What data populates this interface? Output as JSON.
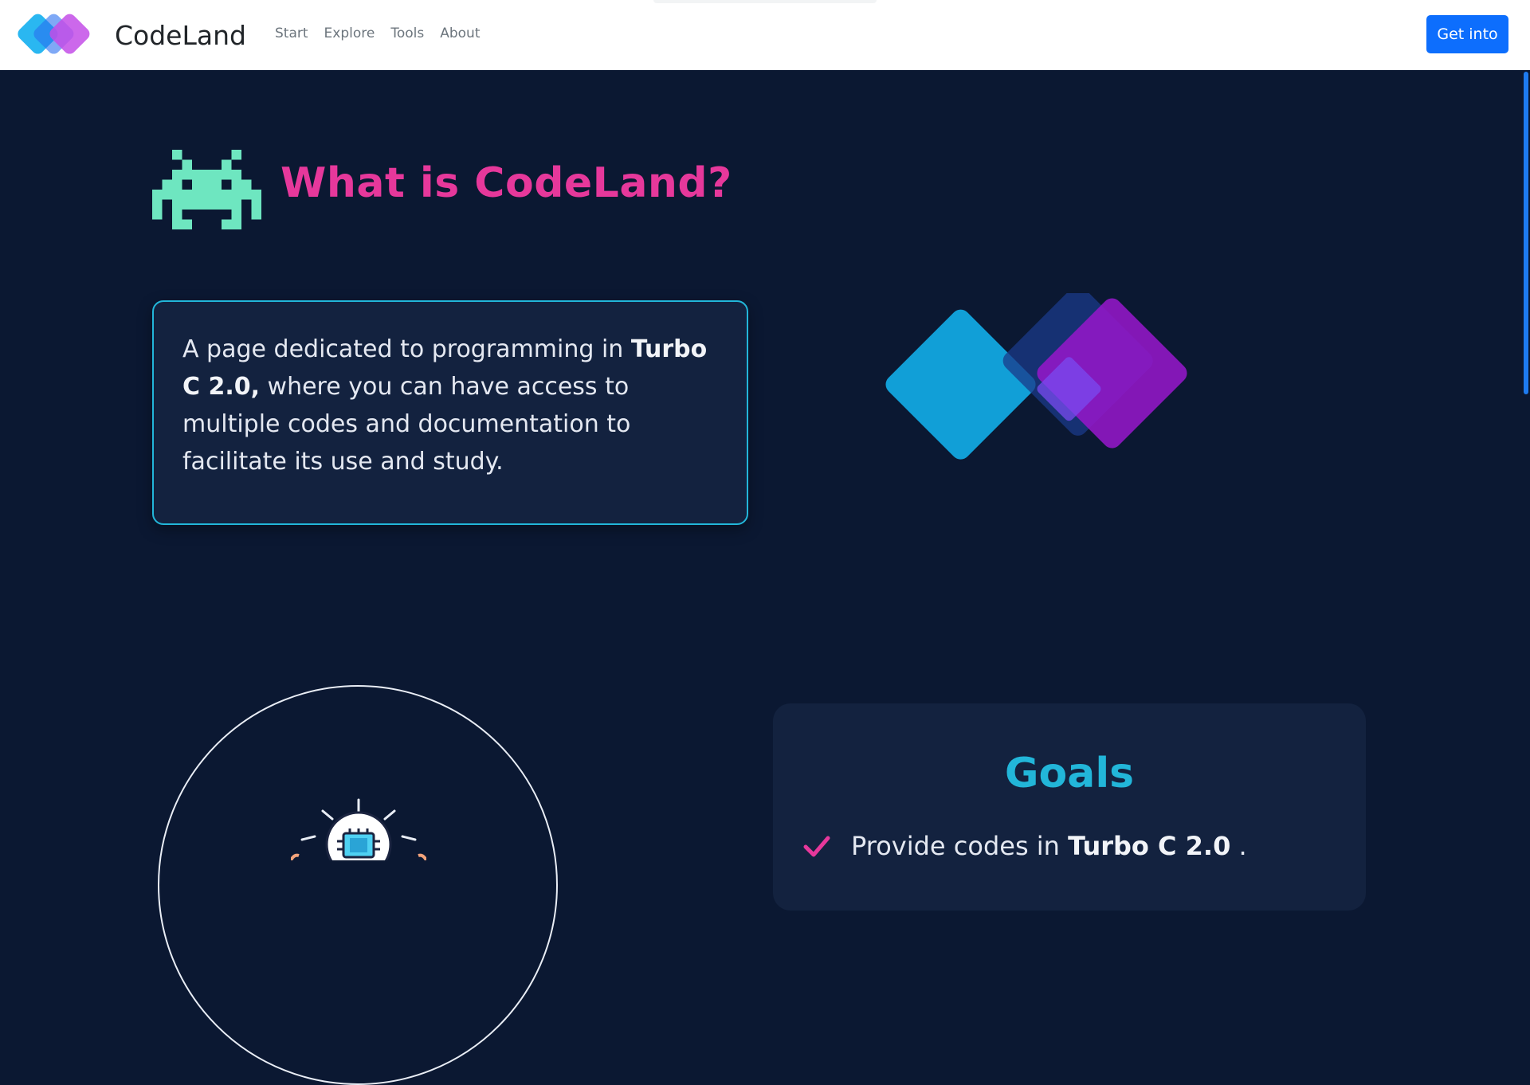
{
  "navbar": {
    "brand_name": "CodeLand",
    "links": [
      "Start",
      "Explore",
      "Tools",
      "About"
    ],
    "cta_label": "Get into"
  },
  "hero": {
    "title": "What is CodeLand?",
    "description": {
      "part1": "A page dedicated to programming in ",
      "bold1": "Turbo C 2.0,",
      "part2": " where you can have access to multiple codes and documentation to facilitate its use and study."
    }
  },
  "goals": {
    "title": "Goals",
    "items": [
      {
        "prefix": "Provide codes in ",
        "bold": "Turbo C 2.0",
        "suffix": " ."
      }
    ]
  },
  "colors": {
    "background": "#0b1832",
    "card": "#13223f",
    "accent_pink": "#e6389b",
    "accent_cyan": "#22b6d9",
    "invader_green": "#6ee6c0",
    "button_blue": "#0d6efd"
  },
  "icons": [
    "brand-logo-icon",
    "space-invader-icon",
    "overlapping-diamonds-icon",
    "lightbulb-chip-icon",
    "checkmark-icon"
  ]
}
